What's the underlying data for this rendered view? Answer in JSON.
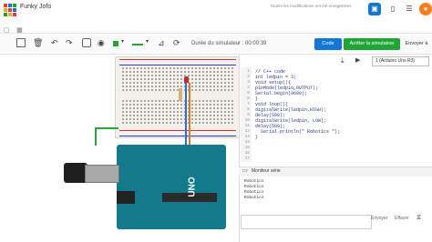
{
  "app": {
    "title": "Funky Jofo",
    "saved_message": "Toutes les modifications ont été enregistrées"
  },
  "toolbar": {
    "sim_duration_label": "Durée du simulateur : 00:00:39",
    "code_label": "Code",
    "stop_label": "Arrêter la simulation",
    "send_label": "Envoyer à",
    "accent_blue": "#1477d4",
    "accent_green": "#1fa637"
  },
  "code_panel": {
    "device_label": "1 (Arduino Uno R3)",
    "line_numbers": [
      "1",
      "2",
      "3",
      "4",
      "5",
      "6",
      "7",
      "8",
      "9",
      "10",
      "11",
      "12",
      "13",
      "14",
      "15",
      "16",
      "17"
    ],
    "lines": [
      "// C++ code",
      "int ledpin = 3;",
      "void setup(){",
      "pinMode(ledpin,OUTPUT);",
      "Serial.begin(9600);",
      "}",
      "void loop(){",
      "digitalWrite(ledpin,HIGH);",
      "delay(500);",
      "digitalWrite(ledpin, LOW);",
      "delay(500);",
      "  Serial.println(\" Robotics \");",
      "}"
    ]
  },
  "serial_monitor": {
    "title": "Moniteur série",
    "lines": [
      "Robotics",
      "Robotics",
      "Robotics",
      "Robotics"
    ],
    "send_label": "Envoyer",
    "clear_label": "Effacer"
  },
  "board": {
    "uno_label": "UNO"
  }
}
